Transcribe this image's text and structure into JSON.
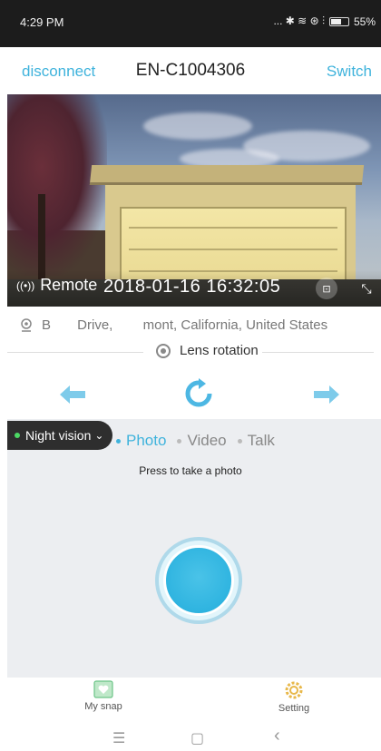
{
  "status_bar": {
    "time": "4:29 PM",
    "icons_text": "... ✱ ≋ ⊛ ⫶",
    "battery_percent": "55%"
  },
  "header": {
    "left_action": "disconnect",
    "title": "EN-C1004306",
    "right_action": "Switch"
  },
  "camera": {
    "mode_label": "Remote",
    "timestamp": "2018-01-16  16:32:05"
  },
  "location": {
    "text": "B       Drive,        mont, California, United States"
  },
  "lens": {
    "label": "Lens rotation"
  },
  "night_vision": {
    "label": "Night vision",
    "chevron": "⌄"
  },
  "modes": [
    {
      "label": "Photo",
      "active": true
    },
    {
      "label": "Video",
      "active": false
    },
    {
      "label": "Talk",
      "active": false
    }
  ],
  "hint": "Press to take a photo",
  "bottom_tabs": {
    "left": "My snap",
    "right": "Setting"
  },
  "nav": {
    "menu": "☰",
    "home": "▢",
    "back": "‹"
  },
  "colors": {
    "accent": "#3fb3dc",
    "status_bar": "#1c1c1c",
    "panel": "#eceef1",
    "night_vision_bg": "#2e2e2e",
    "night_vision_dot": "#4cd964"
  }
}
